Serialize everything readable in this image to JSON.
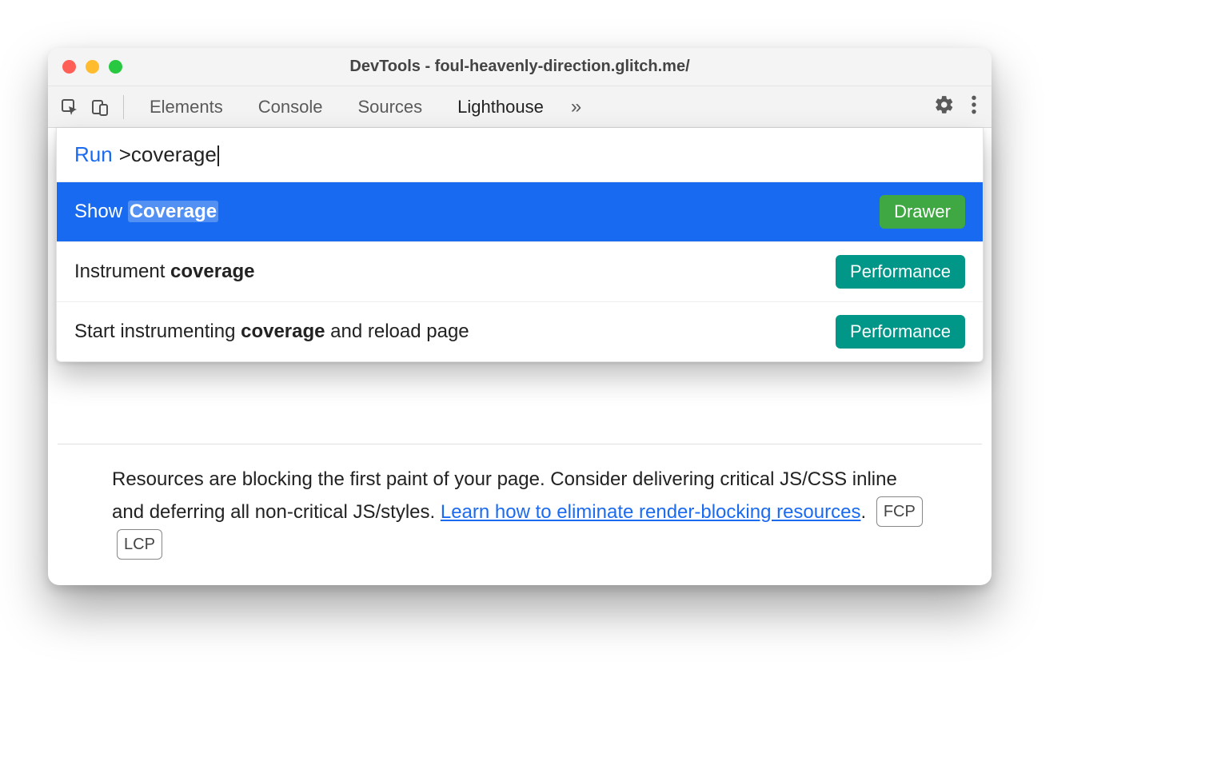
{
  "window": {
    "title": "DevTools - foul-heavenly-direction.glitch.me/"
  },
  "tabs": {
    "elements": "Elements",
    "console": "Console",
    "sources": "Sources",
    "lighthouse": "Lighthouse"
  },
  "command_menu": {
    "prefix": "Run",
    "query": ">coverage",
    "items": [
      {
        "pre": "Show ",
        "hl": "Coverage",
        "post": "",
        "badge": "Drawer",
        "badge_kind": "drawer",
        "selected": true
      },
      {
        "pre": "Instrument ",
        "hl": "coverage",
        "post": "",
        "badge": "Performance",
        "badge_kind": "perf",
        "selected": false
      },
      {
        "pre": "Start instrumenting ",
        "hl": "coverage",
        "post": " and reload page",
        "badge": "Performance",
        "badge_kind": "perf",
        "selected": false
      }
    ]
  },
  "message": {
    "text_a": "Resources are blocking the first paint of your page. Consider delivering critical JS/CSS inline and deferring all non-critical JS/styles. ",
    "link": "Learn how to eliminate render-blocking resources",
    "text_b": ". ",
    "chip1": "FCP",
    "chip2": "LCP"
  }
}
